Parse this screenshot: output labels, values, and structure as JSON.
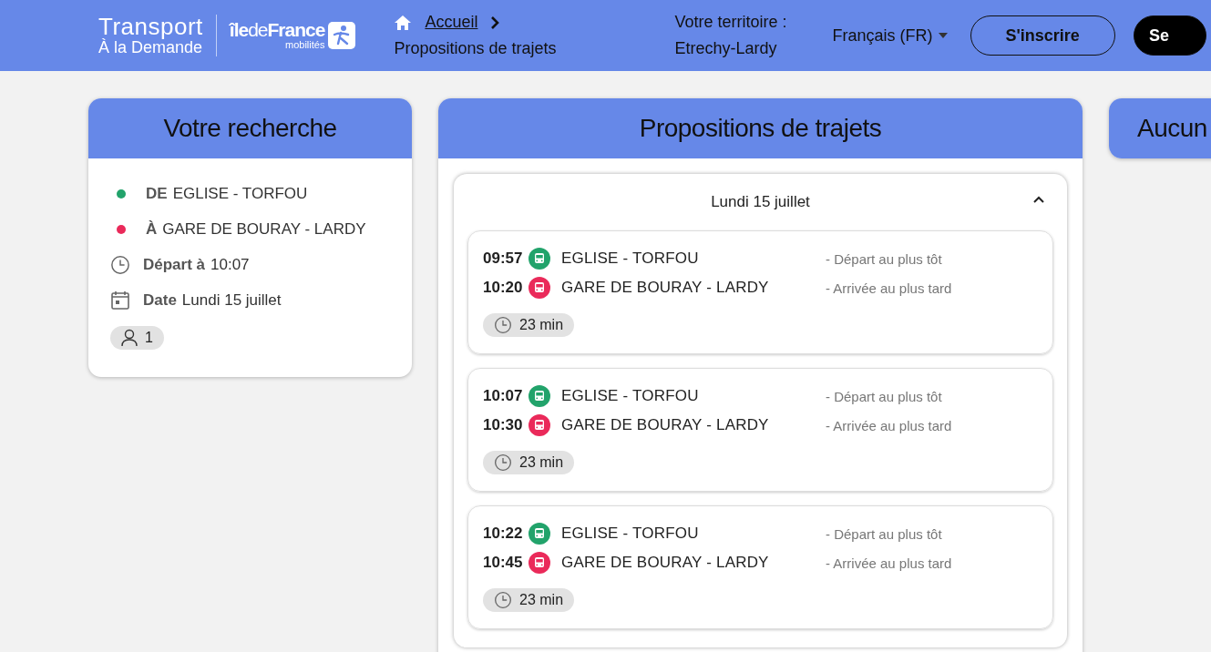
{
  "header": {
    "brand": {
      "title": "Transport",
      "subtitle": "À la Demande"
    },
    "partner_logo": {
      "name": "**île**de**France**",
      "sub": "mobilités"
    },
    "breadcrumb": {
      "home": "Accueil",
      "current": "Propositions de trajets"
    },
    "territory": {
      "label": "Votre territoire :",
      "value": "Etrechy-Lardy"
    },
    "language": "Français (FR)",
    "buttons": [
      {
        "label": "S'inscrire",
        "kind": "outline"
      },
      {
        "label": "Se",
        "kind": "filled"
      }
    ]
  },
  "search": {
    "title": "Votre recherche",
    "stops": [
      {
        "prefix": "DE",
        "name": "EGLISE - TORFOU",
        "color": "#22a36b"
      },
      {
        "prefix": "À",
        "name": "GARE DE BOURAY - LARDY",
        "color": "#ea2a5a"
      }
    ],
    "departure": {
      "label": "Départ à",
      "value": "10:07"
    },
    "date": {
      "label": "Date",
      "value": "Lundi 15 juillet"
    },
    "passengers": "1"
  },
  "results": {
    "title": "Propositions de trajets",
    "day": {
      "label": "Lundi 15 juillet",
      "expanded": true
    },
    "trips": [
      {
        "legs": [
          {
            "time": "09:57",
            "stop": "EGLISE - TORFOU",
            "note": "- Départ au plus tôt",
            "color": "#22a36b"
          },
          {
            "time": "10:20",
            "stop": "GARE DE BOURAY - LARDY",
            "note": "- Arrivée au plus tard",
            "color": "#ea2a5a"
          }
        ],
        "duration": "23 min"
      },
      {
        "legs": [
          {
            "time": "10:07",
            "stop": "EGLISE - TORFOU",
            "note": "- Départ au plus tôt",
            "color": "#22a36b"
          },
          {
            "time": "10:30",
            "stop": "GARE DE BOURAY - LARDY",
            "note": "- Arrivée au plus tard",
            "color": "#ea2a5a"
          }
        ],
        "duration": "23 min"
      },
      {
        "legs": [
          {
            "time": "10:22",
            "stop": "EGLISE - TORFOU",
            "note": "- Départ au plus tôt",
            "color": "#22a36b"
          },
          {
            "time": "10:45",
            "stop": "GARE DE BOURAY - LARDY",
            "note": "- Arrivée au plus tard",
            "color": "#ea2a5a"
          }
        ],
        "duration": "23 min"
      }
    ]
  },
  "side_panel": {
    "title": "Aucun"
  }
}
